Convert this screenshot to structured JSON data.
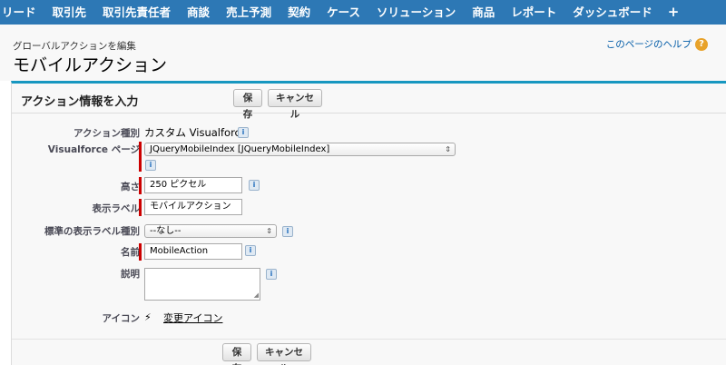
{
  "tabs": [
    "リード",
    "取引先",
    "取引先責任者",
    "商談",
    "売上予測",
    "契約",
    "ケース",
    "ソリューション",
    "商品",
    "レポート",
    "ダッシュボード",
    "+"
  ],
  "header": {
    "subtitle": "グローバルアクションを編集",
    "title": "モバイルアクション",
    "help_link": "このページのヘルプ",
    "help_icon": "?"
  },
  "section": {
    "title": "アクション情報を入力",
    "save_label": "保存",
    "cancel_label": "キャンセル"
  },
  "fields": {
    "action_type": {
      "label": "アクション種別",
      "value": "カスタム Visualforce"
    },
    "visualforce_page": {
      "label": "Visualforce ページ",
      "value": "JQueryMobileIndex [JQueryMobileIndex]"
    },
    "height": {
      "label": "高さ",
      "value": "250 ピクセル"
    },
    "display_label": {
      "label": "表示ラベル",
      "value": "モバイルアクション"
    },
    "standard_label_type": {
      "label": "標準の表示ラベル種別",
      "value": "--なし--"
    },
    "name": {
      "label": "名前",
      "value": "MobileAction"
    },
    "description": {
      "label": "説明",
      "value": ""
    },
    "icon": {
      "label": "アイコン",
      "link": "変更アイコン",
      "glyph": "⚡"
    }
  },
  "info_glyph": "i",
  "colors": {
    "tab_bar": "#2d78b5",
    "section_border": "#1797c0",
    "required_bar": "#cc0000",
    "help_icon": "#e8a22a",
    "link": "#015ba7"
  },
  "icons": [
    "info-icon",
    "help-icon",
    "lightning-icon",
    "select-arrow-icon",
    "resize-grip-icon"
  ]
}
